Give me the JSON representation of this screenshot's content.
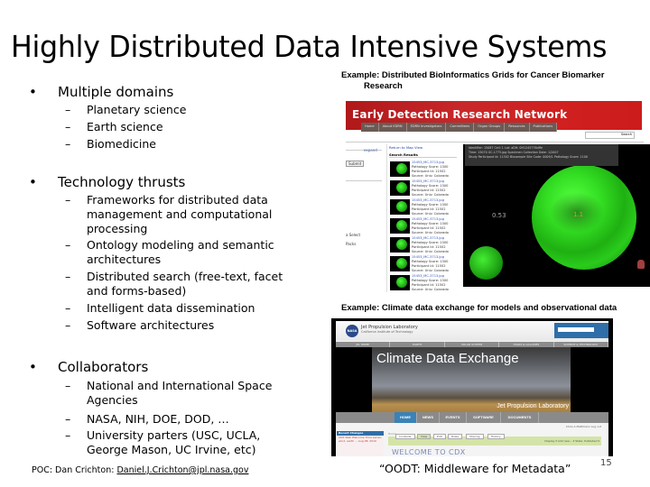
{
  "slide": {
    "title": "Highly Distributed Data Intensive Systems",
    "page_number": "15",
    "footer_title": "“OODT: Middleware for Metadata”"
  },
  "bullets": [
    {
      "label": "Multiple domains",
      "sub": [
        "Planetary science",
        "Earth science",
        "Biomedicine"
      ]
    },
    {
      "label": "Technology thrusts",
      "sub": [
        "Frameworks for distributed data management and computational processing",
        "Ontology modeling and semantic architectures",
        "Distributed search (free-text, facet and forms-based)",
        "Intelligent data dissemination",
        "Software architectures"
      ]
    },
    {
      "label": "Collaborators",
      "sub": [
        "National and International Space Agencies",
        "NASA, NIH, DOE, DOD, …",
        "University parters (USC, UCLA, George Mason, UC Irvine, etc)"
      ]
    }
  ],
  "bullet_glyph": "•",
  "dash_glyph": "–",
  "poc": {
    "label": "POC: Dan Crichton: ",
    "email": "Daniel.J.Crichton@jpl.nasa.gov"
  },
  "examples": {
    "edrn_caption_line1": "Example: Distributed BioInformatics Grids for Cancer Biomarker",
    "edrn_caption_line2": "Research",
    "climate_caption": "Example: Climate data exchange for models and observational data"
  },
  "edrn": {
    "title": "Early Detection Research Network",
    "nav": [
      "Home",
      "About EDRN",
      "EDRN Investigators",
      "Committees",
      "Organ Groups",
      "Resources",
      "Publications"
    ],
    "search_button": "Search",
    "left_labels": [
      "expand",
      "Submit",
      "a Select",
      "Packs"
    ],
    "results_link": "Return to Map View",
    "results_header": "Search Results",
    "result_items": [
      {
        "file": "15453_MC-3713.jpg",
        "score": "Pathology Score: 1300",
        "participant": "Participant Id: 11502",
        "source": "Source: Univ. Colorado"
      },
      {
        "file": "15453_MC-3713.jpg",
        "score": "Pathology Score: 1300",
        "participant": "Participant Id: 11502",
        "source": "Source: Univ. Colorado"
      },
      {
        "file": "15453_MC-3713.jpg",
        "score": "Pathology Score: 1300",
        "participant": "Participant Id: 11502",
        "source": "Source: Univ. Colorado"
      },
      {
        "file": "15453_MC-3713.jpg",
        "score": "Pathology Score: 1300",
        "participant": "Participant Id: 11502",
        "source": "Source: Univ. Colorado"
      },
      {
        "file": "15453_MC-3713.jpg",
        "score": "Pathology Score: 1300",
        "participant": "Participant Id: 11502",
        "source": "Source: Univ. Colorado"
      },
      {
        "file": "15453_MC-3713.jpg",
        "score": "Pathology Score: 1300",
        "participant": "Participant Id: 11502",
        "source": "Source: Univ. Colorado"
      },
      {
        "file": "15453_MC-3713.jpg",
        "score": "Pathology Score: 1300",
        "participant": "Participant Id: 11502",
        "source": "Source: Univ. Colorado"
      }
    ],
    "viewer_info": [
      "Identifier: 15087  Cell: 1  Lot: aDH: 0H1245776dffe",
      "Time: 15070 UC-1775.jpg  Specimen Collection Date: 1/2007",
      "Study Participant Id: 11502   Biosample Site Code: 0009/1   Pathology Score: 1100"
    ],
    "viewer_value_left": "0.53",
    "viewer_value_right": "1.1"
  },
  "climate": {
    "org_name": "Jet Propulsion Laboratory",
    "org_sub": "California Institute of Technology",
    "nasa_logo": "NASA",
    "top_nav": [
      "JPL HOME",
      "EARTH",
      "SOLAR SYSTEM",
      "STARS & GALAXIES",
      "SCIENCE & TECHNOLOGY"
    ],
    "banner_title": "Climate Data Exchange",
    "banner_sub": "Jet Propulsion Laboratory",
    "main_nav": [
      "HOME",
      "NEWS",
      "EVENTS",
      "SOFTWARE",
      "DOCUMENTS"
    ],
    "active_nav": "HOME",
    "user_line": "Chris A Mattmann  Log out",
    "recent_header": "Recent Changes",
    "recent_body": "CDX Web Welcome Time series, wind, earth ... Aug 08, 2010",
    "crumb": "Home",
    "tabs": [
      "Contents",
      "View",
      "Edit",
      "Rules",
      "Sharing",
      "History"
    ],
    "active_tab": "View",
    "tab_actions": "Display ▾  Add new… ▾  State: Published ▾",
    "welcome": "WELCOME TO CDX"
  }
}
